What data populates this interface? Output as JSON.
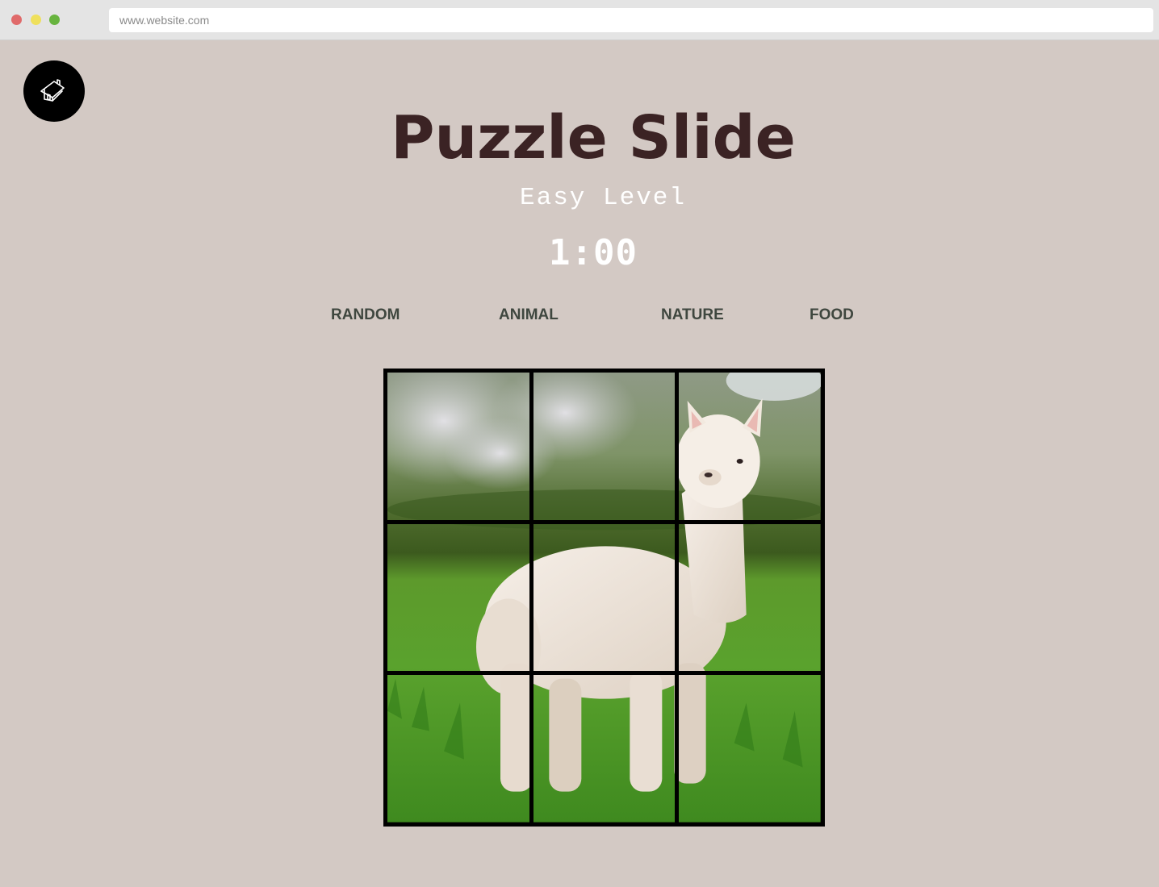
{
  "browser": {
    "url": "www.website.com"
  },
  "home": {
    "icon": "home-icon"
  },
  "game": {
    "title": "Puzzle Slide",
    "level": "Easy Level",
    "timer": "1:00"
  },
  "categories": [
    {
      "label": "RANDOM"
    },
    {
      "label": "ANIMAL"
    },
    {
      "label": "NATURE"
    },
    {
      "label": "FOOD"
    }
  ],
  "board": {
    "rows": 3,
    "cols": 3,
    "image": "alpaca-in-grass"
  },
  "colors": {
    "background": "#d3c9c4",
    "title": "#3b2324",
    "category": "#3f473f",
    "board_border": "#000000"
  }
}
